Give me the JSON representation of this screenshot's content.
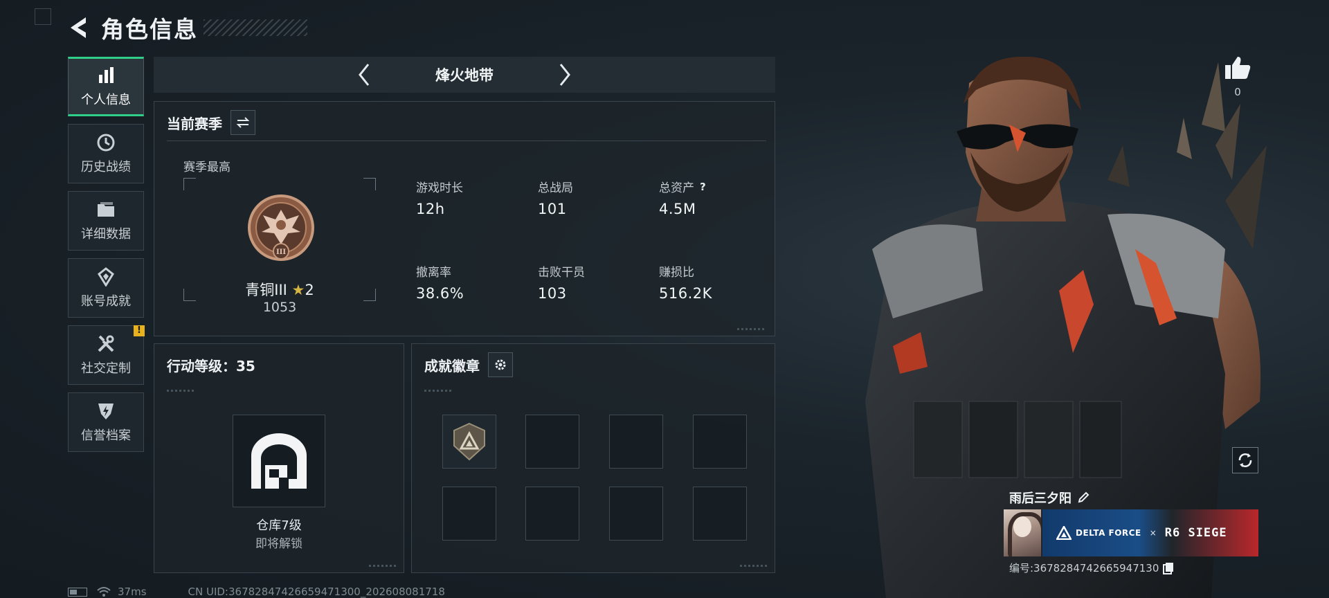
{
  "header": {
    "title": "角色信息"
  },
  "nav": {
    "items": [
      {
        "label": "个人信息",
        "icon": "bar-chart-icon",
        "active": true
      },
      {
        "label": "历史战绩",
        "icon": "history-clock-icon"
      },
      {
        "label": "详细数据",
        "icon": "folder-icon"
      },
      {
        "label": "账号成就",
        "icon": "achievement-icon"
      },
      {
        "label": "社交定制",
        "icon": "tools-icon",
        "badge": "!"
      },
      {
        "label": "信誉档案",
        "icon": "shield-bolt-icon"
      }
    ]
  },
  "mode": {
    "title": "烽火地带"
  },
  "season": {
    "title": "当前赛季",
    "best_label": "赛季最高",
    "rank_name": "青铜III",
    "rank_star_glyph": "★",
    "rank_stars": "2",
    "rank_score": "1053",
    "rank_emblem_numeral": "III",
    "stats": [
      {
        "label": "游戏时长",
        "value": "12h"
      },
      {
        "label": "总战局",
        "value": "101"
      },
      {
        "label": "总资产",
        "value": "4.5M",
        "help": "?"
      },
      {
        "label": "撤离率",
        "value": "38.6%"
      },
      {
        "label": "击败干员",
        "value": "103"
      },
      {
        "label": "赚损比",
        "value": "516.2K"
      }
    ]
  },
  "action_level": {
    "title": "行动等级：35",
    "warehouse_label": "仓库7级",
    "warehouse_sub": "即将解锁"
  },
  "badges": {
    "title": "成就徽章",
    "slots_filled": 1,
    "slots_total": 8
  },
  "character": {
    "likes": "0",
    "player_name": "雨后三夕阳",
    "collab": {
      "left": "DELTA FORCE",
      "x": "×",
      "right": "R6 SIEGE"
    },
    "player_id": "编号:3678284742665947130"
  },
  "status": {
    "ping": "37ms",
    "uid": "CN UID:36782847426659471300_202608081718"
  },
  "colors": {
    "accent_green": "#2fcf8a",
    "warning": "#e8b21f",
    "bronze": "#8a5a43",
    "panel_bg": "#1d252b"
  }
}
